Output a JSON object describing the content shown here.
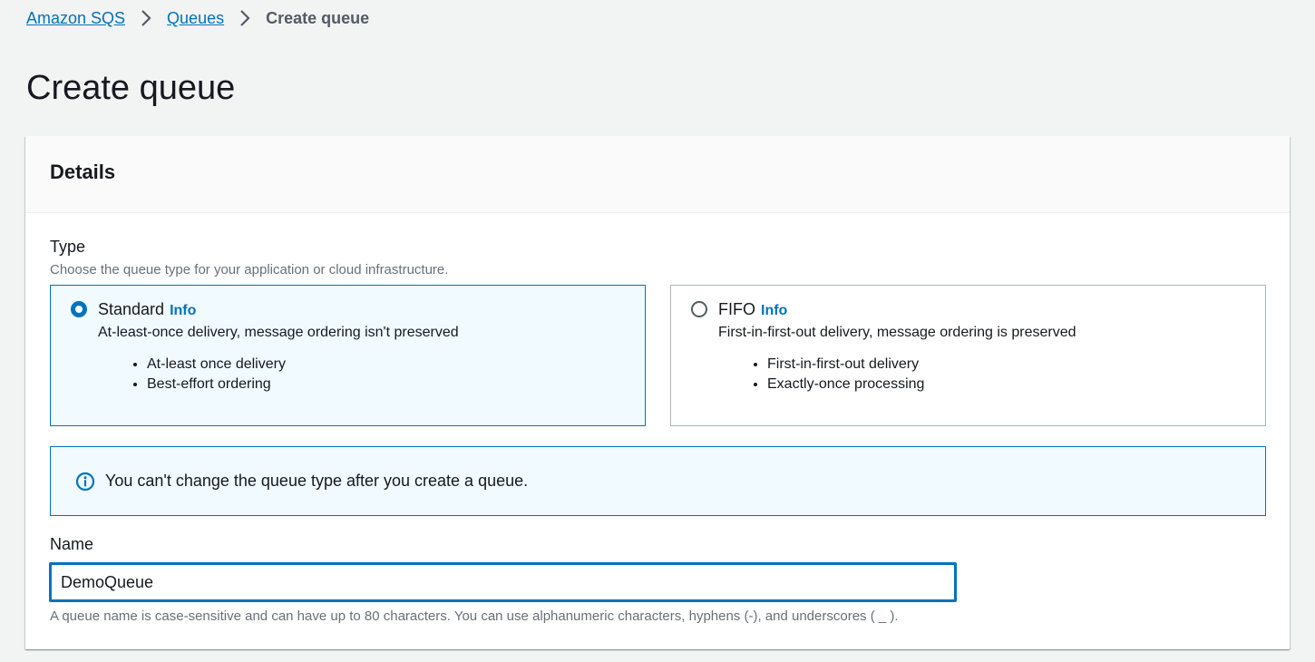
{
  "breadcrumb": {
    "items": [
      "Amazon SQS",
      "Queues"
    ],
    "current": "Create queue"
  },
  "page_title": "Create queue",
  "details": {
    "heading": "Details",
    "type": {
      "label": "Type",
      "description": "Choose the queue type for your application or cloud infrastructure.",
      "options": [
        {
          "title": "Standard",
          "info": "Info",
          "description": "At-least-once delivery, message ordering isn't preserved",
          "bullets": [
            "At-least once delivery",
            "Best-effort ordering"
          ],
          "selected": true
        },
        {
          "title": "FIFO",
          "info": "Info",
          "description": "First-in-first-out delivery, message ordering is preserved",
          "bullets": [
            "First-in-first-out delivery",
            "Exactly-once processing"
          ],
          "selected": false
        }
      ]
    },
    "alert": {
      "icon": "info-icon",
      "text": "You can't change the queue type after you create a queue."
    },
    "name": {
      "label": "Name",
      "value": "DemoQueue",
      "hint": "A queue name is case-sensitive and can have up to 80 characters. You can use alphanumeric characters, hyphens (-), and underscores ( _ )."
    }
  },
  "colors": {
    "accent": "#0073bb",
    "background": "#f2f3f3",
    "selected_tile_bg": "#f1faff"
  }
}
